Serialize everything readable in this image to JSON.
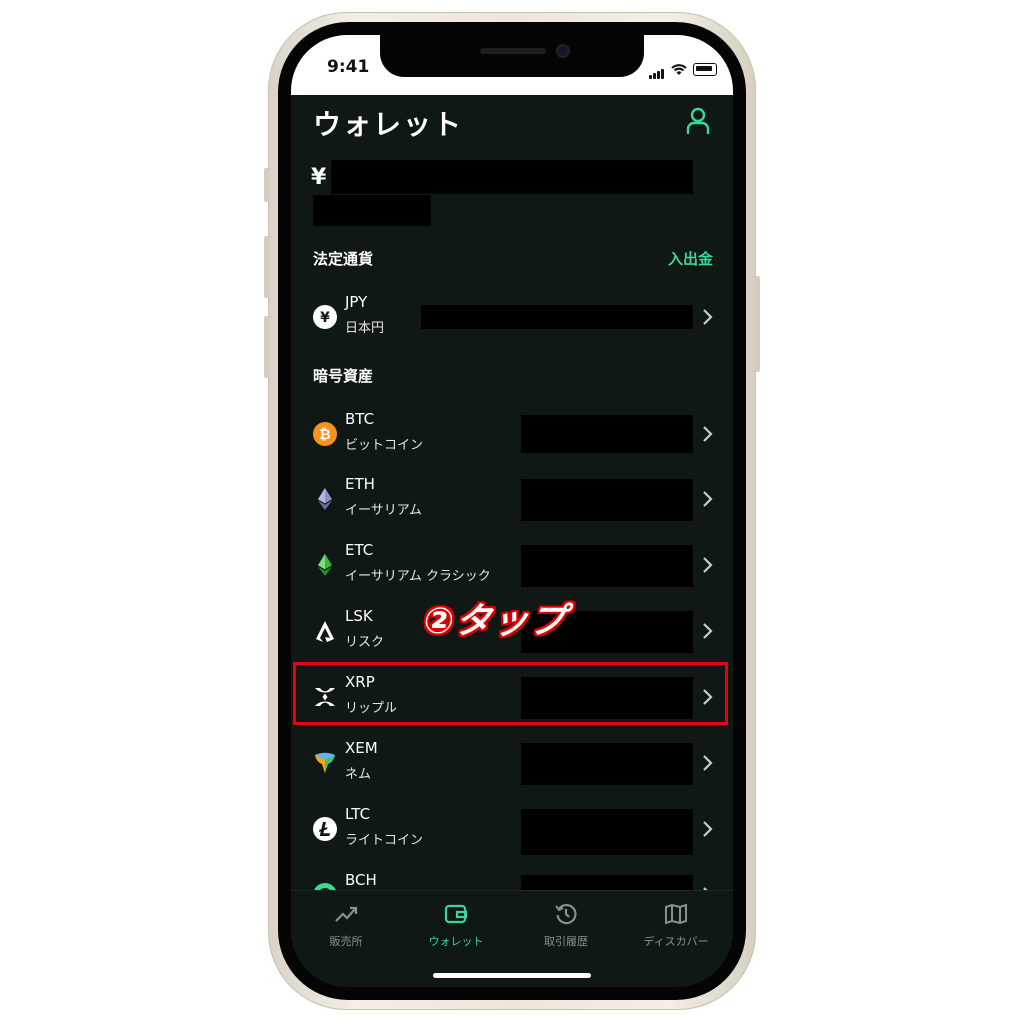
{
  "status_bar": {
    "time": "9:41"
  },
  "header": {
    "title": "ウォレット",
    "currency_symbol": "¥"
  },
  "fiat_section": {
    "label": "法定通貨",
    "action_label": "入出金",
    "items": [
      {
        "symbol": "JPY",
        "name": "日本円",
        "icon": "yen-icon"
      }
    ]
  },
  "crypto_section": {
    "label": "暗号資産",
    "items": [
      {
        "symbol": "BTC",
        "name": "ビットコイン",
        "icon": "bitcoin-icon"
      },
      {
        "symbol": "ETH",
        "name": "イーサリアム",
        "icon": "ethereum-icon"
      },
      {
        "symbol": "ETC",
        "name": "イーサリアム クラシック",
        "icon": "ethereum-classic-icon"
      },
      {
        "symbol": "LSK",
        "name": "リスク",
        "icon": "lisk-icon"
      },
      {
        "symbol": "XRP",
        "name": "リップル",
        "icon": "ripple-icon"
      },
      {
        "symbol": "XEM",
        "name": "ネム",
        "icon": "nem-icon"
      },
      {
        "symbol": "LTC",
        "name": "ライトコイン",
        "icon": "litecoin-icon"
      },
      {
        "symbol": "BCH",
        "name": "",
        "icon": "bitcoin-cash-icon"
      }
    ]
  },
  "annotation": {
    "label": "②タップ",
    "color": "#e60012"
  },
  "tab_bar": {
    "tabs": [
      {
        "label": "販売所",
        "icon": "chart-trend-icon",
        "active": false
      },
      {
        "label": "ウォレット",
        "icon": "wallet-icon",
        "active": true
      },
      {
        "label": "取引履歴",
        "icon": "history-icon",
        "active": false
      },
      {
        "label": "ディスカバー",
        "icon": "map-icon",
        "active": false
      }
    ]
  },
  "colors": {
    "accent": "#3dd598",
    "background": "#0f1814",
    "annotation_red": "#e60012"
  }
}
